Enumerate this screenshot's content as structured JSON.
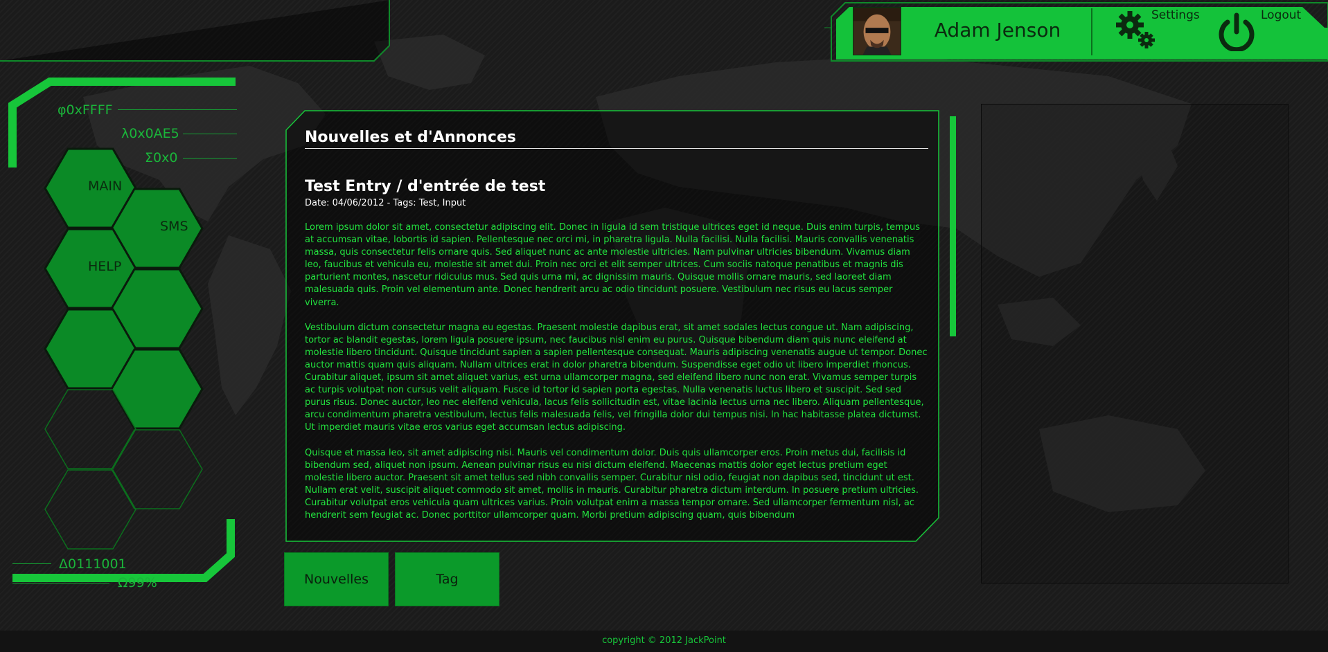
{
  "user": {
    "name": "Adam Jenson",
    "settings_label": "Settings",
    "logout_label": "Logout"
  },
  "hud_codes": {
    "top": [
      "φ0xFFFF",
      "λ0x0AE5",
      "Σ0x0"
    ],
    "bottom": [
      "Δ0111001",
      "Ω99%"
    ]
  },
  "nav": {
    "main": "MAIN",
    "sms": "SMS",
    "help": "HELP"
  },
  "news": {
    "section_title": "Nouvelles et d'Annonces",
    "entry_title": "Test Entry / d'entrée de test",
    "entry_meta": "Date: 04/06/2012 - Tags: Test, Input",
    "paragraphs": [
      "Lorem ipsum dolor sit amet, consectetur adipiscing elit. Donec in ligula id sem tristique ultrices eget id neque. Duis enim turpis, tempus at accumsan vitae, lobortis id sapien. Pellentesque nec orci mi, in pharetra ligula. Nulla facilisi. Nulla facilisi. Mauris convallis venenatis massa, quis consectetur felis ornare quis. Sed aliquet nunc ac ante molestie ultricies. Nam pulvinar ultricies bibendum. Vivamus diam leo, faucibus et vehicula eu, molestie sit amet dui. Proin nec orci et elit semper ultrices. Cum sociis natoque penatibus et magnis dis parturient montes, nascetur ridiculus mus. Sed quis urna mi, ac dignissim mauris. Quisque mollis ornare mauris, sed laoreet diam malesuada quis. Proin vel elementum ante. Donec hendrerit arcu ac odio tincidunt posuere. Vestibulum nec risus eu lacus semper viverra.",
      "Vestibulum dictum consectetur magna eu egestas. Praesent molestie dapibus erat, sit amet sodales lectus congue ut. Nam adipiscing, tortor ac blandit egestas, lorem ligula posuere ipsum, nec faucibus nisl enim eu purus. Quisque bibendum diam quis nunc eleifend at molestie libero tincidunt. Quisque tincidunt sapien a sapien pellentesque consequat. Mauris adipiscing venenatis augue ut tempor. Donec auctor mattis quam quis aliquam. Nullam ultrices erat in dolor pharetra bibendum. Suspendisse eget odio ut libero imperdiet rhoncus. Curabitur aliquet, ipsum sit amet aliquet varius, est urna ullamcorper magna, sed eleifend libero nunc non erat. Vivamus semper turpis ac turpis volutpat non cursus velit aliquam. Fusce id tortor id sapien porta egestas. Nulla venenatis luctus libero et suscipit. Sed sed purus risus. Donec auctor, leo nec eleifend vehicula, lacus felis sollicitudin est, vitae lacinia lectus urna nec libero. Aliquam pellentesque, arcu condimentum pharetra vestibulum, lectus felis malesuada felis, vel fringilla dolor dui tempus nisi. In hac habitasse platea dictumst. Ut imperdiet mauris vitae eros varius eget accumsan lectus adipiscing.",
      "Quisque et massa leo, sit amet adipiscing nisi. Mauris vel condimentum dolor. Duis quis ullamcorper eros. Proin metus dui, facilisis id bibendum sed, aliquet non ipsum. Aenean pulvinar risus eu nisi dictum eleifend. Maecenas mattis dolor eget lectus pretium eget molestie libero auctor. Praesent sit amet tellus sed nibh convallis semper. Curabitur nisl odio, feugiat non dapibus sed, tincidunt ut est. Nullam erat velit, suscipit aliquet commodo sit amet, mollis in mauris. Curabitur pharetra dictum interdum. In posuere pretium ultricies. Curabitur volutpat eros vehicula quam ultrices varius. Proin volutpat enim a massa tempor ornare. Sed ullamcorper fermentum nisl, ac hendrerit sem feugiat ac. Donec porttitor ullamcorper quam. Morbi pretium adipiscing quam, quis bibendum"
    ]
  },
  "buttons": {
    "nouvelles": "Nouvelles",
    "tag": "Tag"
  },
  "footer": {
    "copyright": "copyright © 2012 JackPoint"
  },
  "icons": {
    "settings": "gears-icon",
    "logout": "power-icon",
    "avatar": "user-avatar"
  },
  "colors": {
    "accent": "#17c63a",
    "bright_green": "#22e33f",
    "panel_green": "#0b9a2a",
    "background": "#1b1b1b"
  }
}
